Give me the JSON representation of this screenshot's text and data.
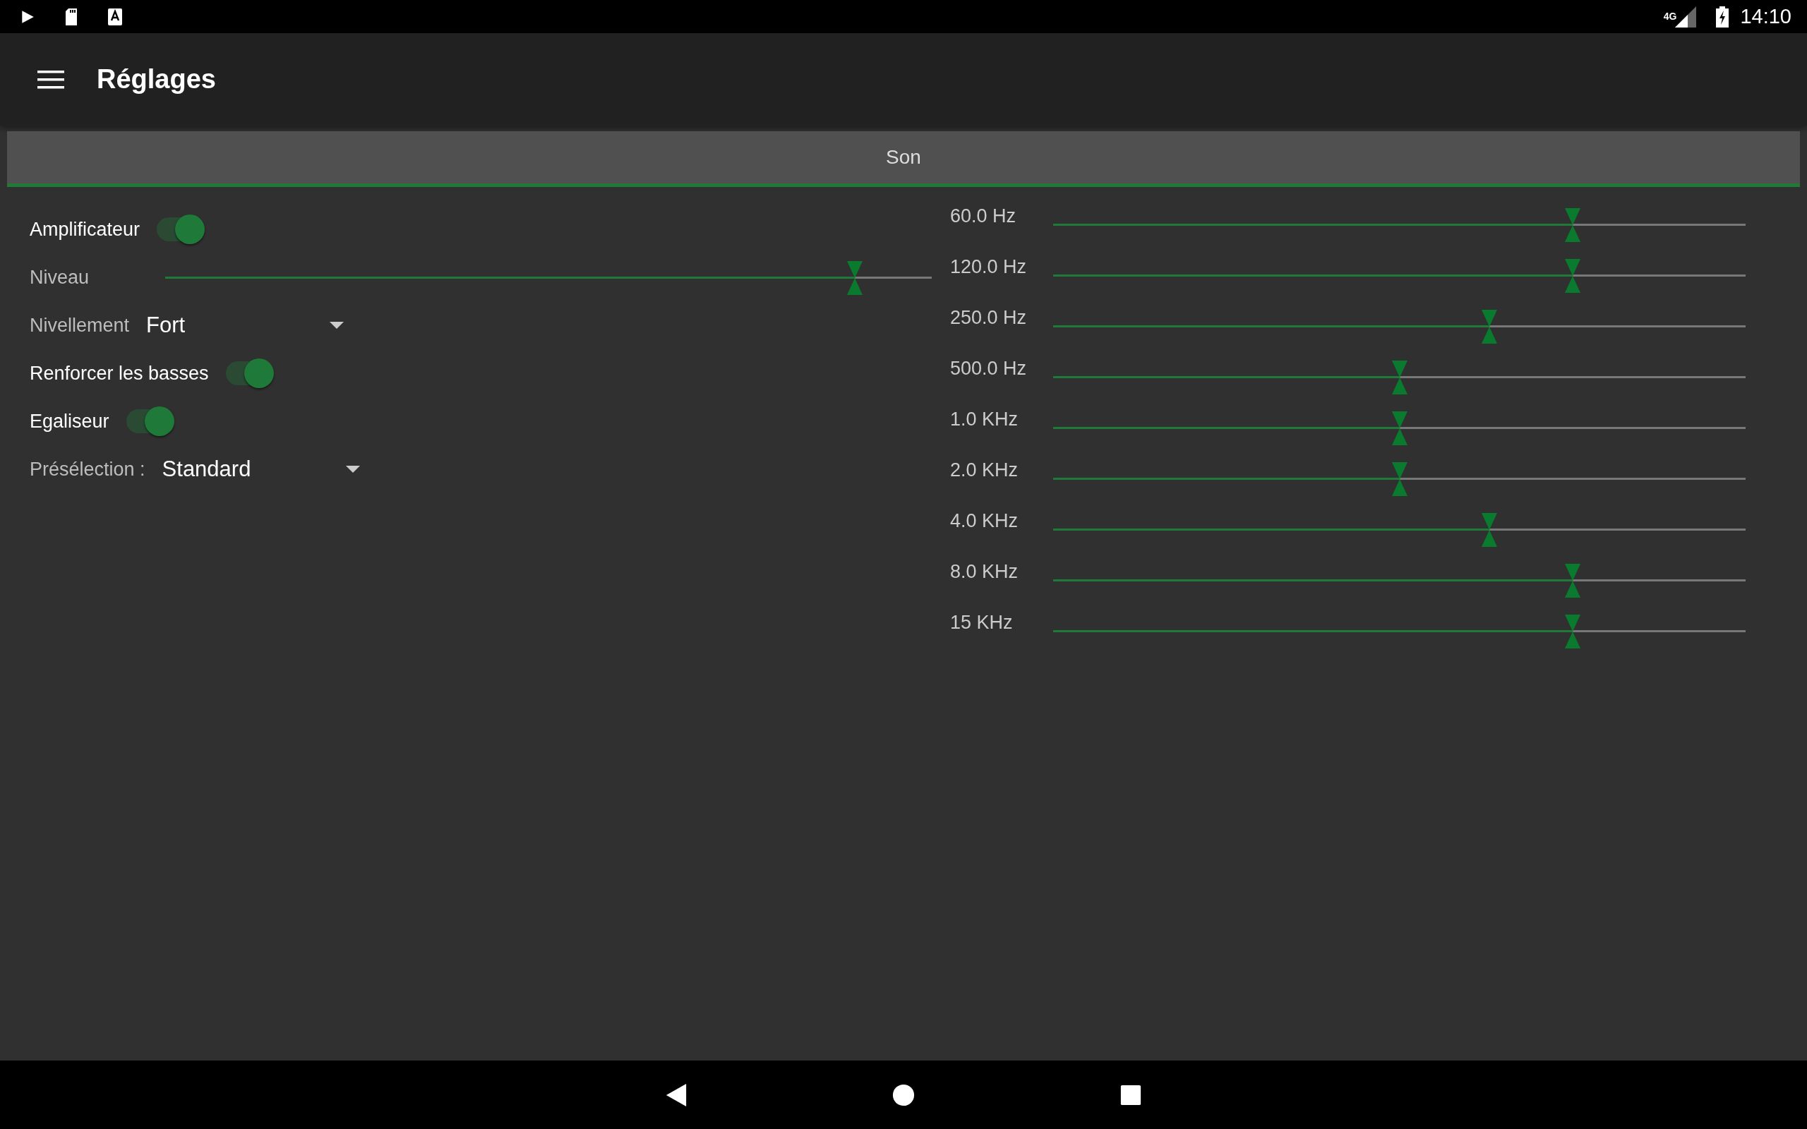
{
  "status_bar": {
    "network": "4G",
    "time": "14:10"
  },
  "app_bar": {
    "title": "Réglages"
  },
  "tabs": [
    {
      "label": "Son",
      "selected": true
    }
  ],
  "settings": [
    {
      "kind": "toggle",
      "label": "Amplificateur",
      "checked": true
    },
    {
      "kind": "slider",
      "label": "Niveau",
      "level": 0.9
    },
    {
      "kind": "dropdown",
      "label": "Nivellement",
      "value": "Fort"
    },
    {
      "kind": "toggle",
      "label": "Renforcer les basses",
      "checked": true
    },
    {
      "kind": "toggle",
      "label": "Egaliseur",
      "checked": true
    },
    {
      "kind": "dropdown",
      "label": "Présélection :",
      "value": "Standard"
    }
  ],
  "equalizer": [
    {
      "band": "60.0 Hz",
      "level": 0.75
    },
    {
      "band": "120.0 Hz",
      "level": 0.75
    },
    {
      "band": "250.0 Hz",
      "level": 0.63
    },
    {
      "band": "500.0 Hz",
      "level": 0.5
    },
    {
      "band": "1.0 KHz",
      "level": 0.5
    },
    {
      "band": "2.0 KHz",
      "level": 0.5
    },
    {
      "band": "4.0 KHz",
      "level": 0.63
    },
    {
      "band": "8.0 KHz",
      "level": 0.75
    },
    {
      "band": "15 KHz",
      "level": 0.75
    }
  ]
}
